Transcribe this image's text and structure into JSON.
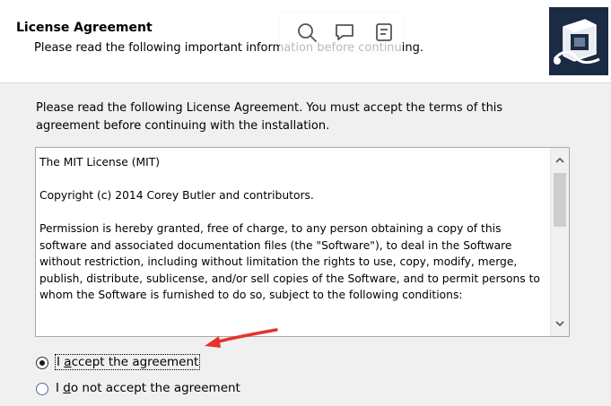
{
  "header": {
    "title": "License Agreement",
    "subtitle": "Please read the following important information before continuing."
  },
  "toolbar": {
    "icons": [
      "search-icon",
      "comment-icon",
      "note-icon"
    ]
  },
  "logo": {
    "icon": "installer-logo-icon",
    "background": "#1c2b44"
  },
  "intro_text": "Please read the following License Agreement. You must accept the terms of this agreement before continuing with the installation.",
  "license": {
    "paragraphs": [
      "The MIT License (MIT)",
      "Copyright (c) 2014 Corey Butler and contributors.",
      "Permission is hereby granted, free of charge, to any person obtaining a copy of this software and associated documentation files (the \"Software\"), to deal in the Software without restriction, including without limitation the rights to use, copy, modify, merge, publish, distribute, sublicense, and/or sell copies of the Software, and to permit persons to whom the Software is furnished to do so, subject to the following conditions:"
    ]
  },
  "options": {
    "accept": {
      "accel": "a",
      "before": "I ",
      "after": "ccept the agreement",
      "selected": true
    },
    "decline": {
      "accel": "d",
      "before": "I ",
      "after": "o not accept the agreement",
      "selected": false
    }
  },
  "annotation": {
    "arrow_color": "#e5322d"
  }
}
